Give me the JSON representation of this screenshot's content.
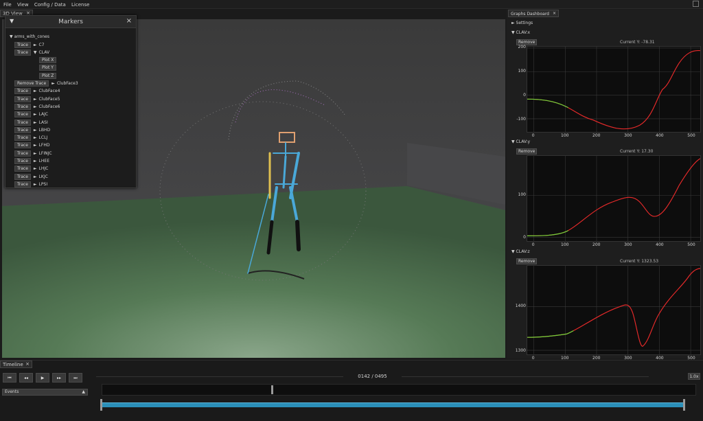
{
  "menu": [
    "File",
    "View",
    "Config / Data",
    "License"
  ],
  "view3d": {
    "tab_label": "3D View",
    "close": "×"
  },
  "markers": {
    "title": "Markers",
    "root": "arms_with_cones",
    "rows": [
      {
        "btn": "Trace",
        "label": "C7",
        "arrow": "►"
      },
      {
        "btn": "Trace",
        "label": "CLAV",
        "arrow": "▼"
      },
      {
        "sub": "Plot X"
      },
      {
        "sub": "Plot Y"
      },
      {
        "sub": "Plot Z"
      },
      {
        "btn": "Remove Trace",
        "label": "ClubFace3",
        "arrow": "►"
      },
      {
        "btn": "Trace",
        "label": "ClubFace4",
        "arrow": "►"
      },
      {
        "btn": "Trace",
        "label": "ClubFace5",
        "arrow": "►"
      },
      {
        "btn": "Trace",
        "label": "ClubFace6",
        "arrow": "►"
      },
      {
        "btn": "Trace",
        "label": "LAJC",
        "arrow": "►"
      },
      {
        "btn": "Trace",
        "label": "LASI",
        "arrow": "►"
      },
      {
        "btn": "Trace",
        "label": "LBHD",
        "arrow": "►"
      },
      {
        "btn": "Trace",
        "label": "LCLJ",
        "arrow": "►"
      },
      {
        "btn": "Trace",
        "label": "LFHD",
        "arrow": "►"
      },
      {
        "btn": "Trace",
        "label": "LFINJC",
        "arrow": "►"
      },
      {
        "btn": "Trace",
        "label": "LHEE",
        "arrow": "►"
      },
      {
        "btn": "Trace",
        "label": "LHJC",
        "arrow": "►"
      },
      {
        "btn": "Trace",
        "label": "LKJC",
        "arrow": "►"
      },
      {
        "btn": "Trace",
        "label": "LPSI",
        "arrow": "►"
      }
    ]
  },
  "graphs": {
    "tab_label": "Graphs Dashboard",
    "settings": "Settings",
    "remove_label": "Remove",
    "sections": [
      {
        "title": "CLAV:x",
        "current": "Current Y: -78.31",
        "yticks": [
          "200",
          "100",
          "0",
          "-100"
        ]
      },
      {
        "title": "CLAV:y",
        "current": "Current Y: 17.30",
        "yticks": [
          "100",
          "0"
        ]
      },
      {
        "title": "CLAV:z",
        "current": "Current Y: 1323.53",
        "yticks": [
          "1400",
          "1300"
        ]
      }
    ],
    "xticks": [
      "0",
      "100",
      "200",
      "300",
      "400",
      "500"
    ]
  },
  "timeline": {
    "tab_label": "Timeline",
    "frame": "0142 / 0495",
    "speed": "1.0x",
    "events": "Events",
    "buttons": [
      "⏮",
      "◂◂",
      "▶",
      "▸▸",
      "⏭"
    ]
  },
  "colors": {
    "accent": "#2b8fb8",
    "pre": "#6fd33a",
    "post": "#e82a2a"
  }
}
